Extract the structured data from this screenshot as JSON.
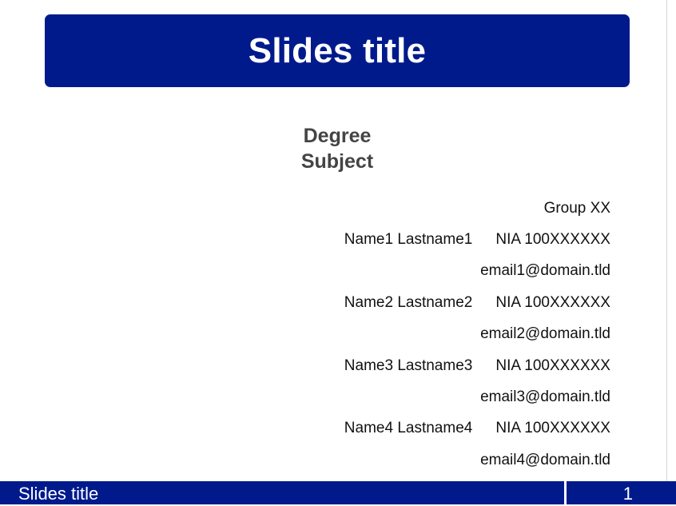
{
  "slide": {
    "title": "Slides title",
    "subtitle_line1": "Degree",
    "subtitle_line2": "Subject",
    "group": "Group XX",
    "members": [
      {
        "name": "Name1 Lastname1",
        "nia": "NIA 100XXXXXX",
        "email": "email1@domain.tld"
      },
      {
        "name": "Name2 Lastname2",
        "nia": "NIA 100XXXXXX",
        "email": "email2@domain.tld"
      },
      {
        "name": "Name3 Lastname3",
        "nia": "NIA 100XXXXXX",
        "email": "email3@domain.tld"
      },
      {
        "name": "Name4 Lastname4",
        "nia": "NIA 100XXXXXX",
        "email": "email4@domain.tld"
      }
    ]
  },
  "footer": {
    "title": "Slides title",
    "page_number": "1"
  },
  "colors": {
    "brand_blue": "#001a8c",
    "subtitle_gray": "#444444"
  }
}
